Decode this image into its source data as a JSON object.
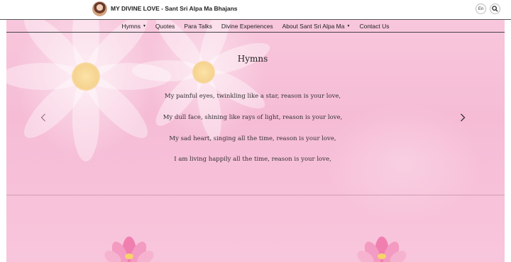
{
  "header": {
    "site_title": "MY DIVINE LOVE - Sant Sri Alpa Ma Bhajans",
    "lang_label": "En"
  },
  "nav": {
    "items": [
      {
        "label": "Hymns"
      },
      {
        "label": "Quotes"
      },
      {
        "label": "Para Talks"
      },
      {
        "label": "Divine Experiences"
      },
      {
        "label": "About Sant Sri Alpa Ma"
      },
      {
        "label": "Contact Us"
      }
    ]
  },
  "content": {
    "heading": "Hymns",
    "lines": [
      "My painful eyes, twinkling like a star, reason is your love,",
      "My dull face, shining like rays of light, reason is your love,",
      "My sad heart, singing all the time, reason is your love,",
      "I am living happily all the time, reason is your love,"
    ]
  },
  "icons": {
    "prev": "chevron-left-icon",
    "next": "chevron-right-icon",
    "search": "search-icon",
    "dropdown": "caret-down-icon",
    "decor": "lotus-icon"
  },
  "colors": {
    "background": "#f8c6dc",
    "text": "#222222"
  }
}
